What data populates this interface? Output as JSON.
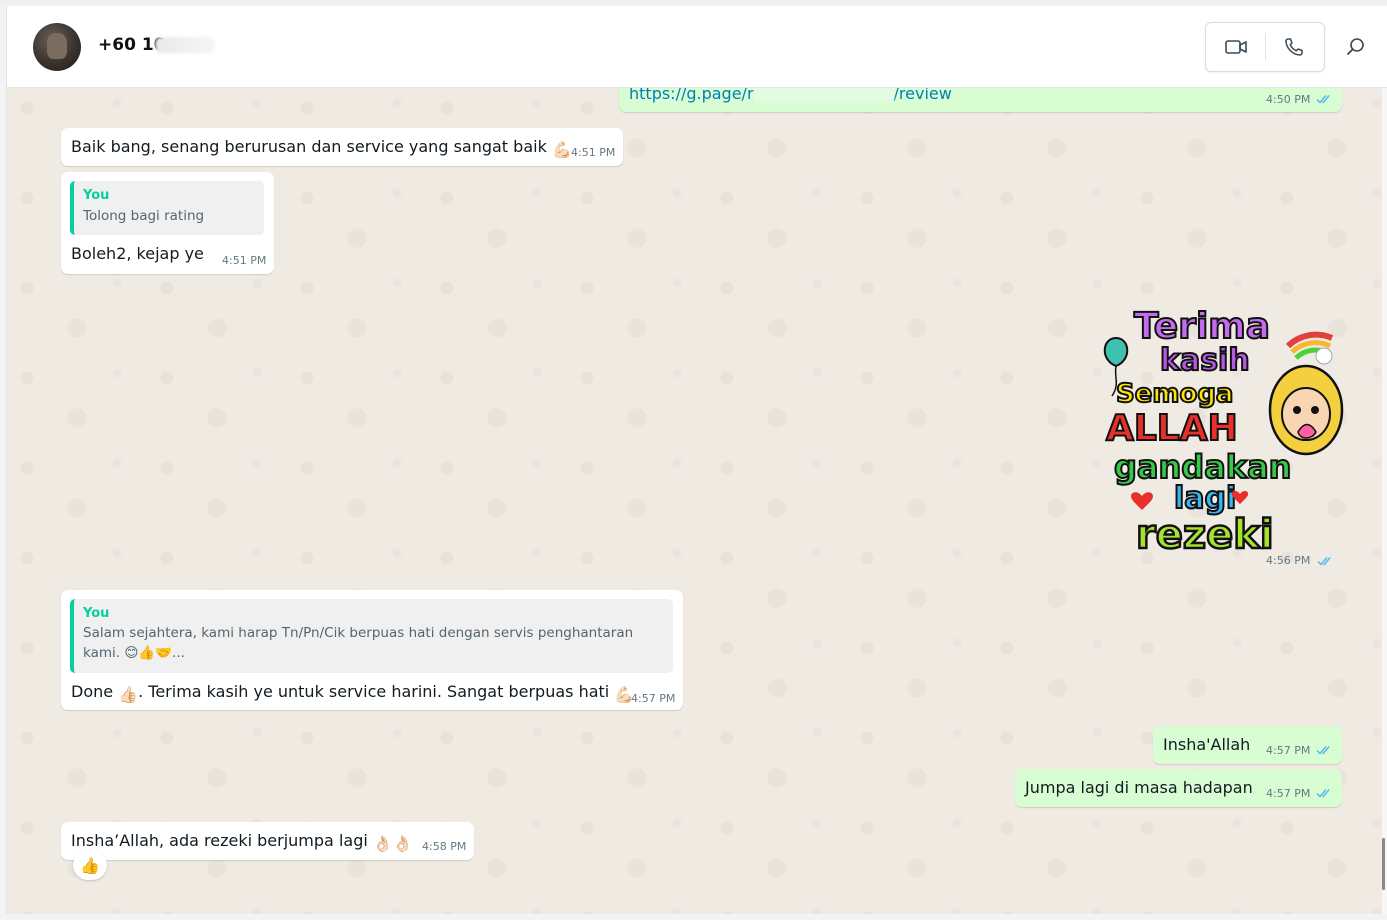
{
  "header": {
    "contact_name": "+60 10",
    "video_call_label": "Video call",
    "voice_call_label": "Voice call",
    "search_label": "Search"
  },
  "messages": {
    "m0": {
      "link_start": "https://g.page/r",
      "link_end": "/review",
      "time": "4:50 PM"
    },
    "m1": {
      "text": "Baik bang, senang berurusan dan service yang sangat baik",
      "emoji": "💪🏻",
      "time": "4:51 PM"
    },
    "m2": {
      "quote_author": "You",
      "quote_text": "Tolong bagi rating",
      "text": "Boleh2, kejap ye",
      "time": "4:51 PM"
    },
    "m3": {
      "sticker_lines": [
        "Terima",
        "kasih",
        "Semoga",
        "ALLAH",
        "gandakan",
        "lagi",
        "rezeki"
      ],
      "time": "4:56 PM"
    },
    "m4": {
      "quote_author": "You",
      "quote_line1": "Salam sejahtera, kami harap Tn/Pn/Cik berpuas hati dengan servis penghantaran",
      "quote_line2": "kami. 😊👍🤝...",
      "text_a": "Done",
      "emoji_a": "👍🏻",
      "text_b": ". Terima kasih ye untuk service harini. Sangat berpuas hati",
      "emoji_b": "💪🏻",
      "time": "4:57 PM"
    },
    "m5": {
      "text": "Insha'Allah",
      "time": "4:57 PM"
    },
    "m6": {
      "text": "Jumpa lagi di masa hadapan",
      "time": "4:57 PM"
    },
    "m7": {
      "text": "Insha’Allah, ada rezeki berjumpa lagi",
      "emoji": "👌🏻👌🏻",
      "time": "4:58 PM",
      "reaction": "👍"
    }
  },
  "colors": {
    "outgoing_bubble": "#d9fdd3",
    "incoming_bubble": "#ffffff",
    "chat_background": "#efeae2",
    "read_ticks": "#53bdeb",
    "quote_accent": "#06cf9c"
  },
  "icons": [
    "video-camera-icon",
    "phone-icon",
    "search-icon",
    "double-check-icon"
  ]
}
